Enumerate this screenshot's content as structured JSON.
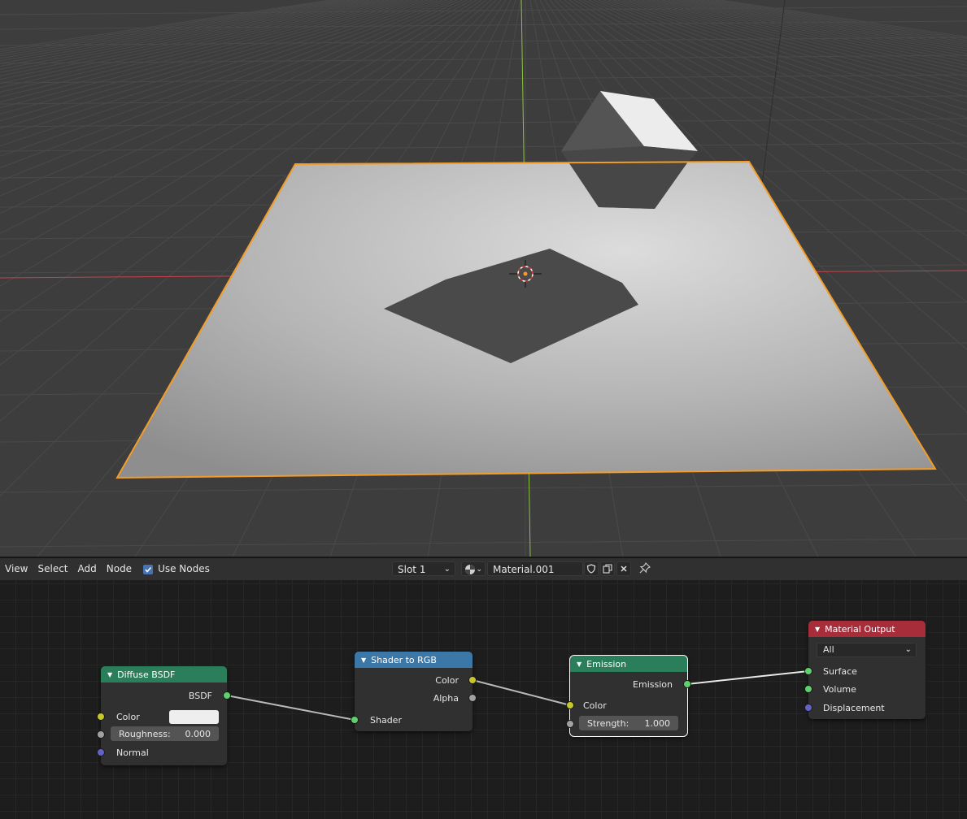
{
  "header": {
    "menu": [
      "View",
      "Select",
      "Add",
      "Node"
    ],
    "use_nodes_label": "Use Nodes",
    "use_nodes_checked": true,
    "slot": "Slot 1",
    "material_name": "Material.001"
  },
  "nodes": {
    "diffuse": {
      "title": "Diffuse BSDF",
      "output": "BSDF",
      "color_label": "Color",
      "roughness_label": "Roughness:",
      "roughness_value": "0.000",
      "normal_label": "Normal",
      "header_color": "#2a7f5a"
    },
    "shader_to_rgb": {
      "title": "Shader to RGB",
      "out_color": "Color",
      "out_alpha": "Alpha",
      "in_shader": "Shader",
      "header_color": "#3b78a8"
    },
    "emission": {
      "title": "Emission",
      "output": "Emission",
      "color_label": "Color",
      "strength_label": "Strength:",
      "strength_value": "1.000",
      "header_color": "#2a7f5a"
    },
    "material_output": {
      "title": "Material Output",
      "target": "All",
      "surface": "Surface",
      "volume": "Volume",
      "displacement": "Displacement",
      "header_color": "#a72d3b"
    }
  },
  "colors": {
    "selection_outline": "#f39c27",
    "x_axis": "#c4434d",
    "y_axis": "#8bc53f",
    "socket_shader": "#5fd16c",
    "socket_color": "#c7c729",
    "socket_float": "#a1a1a1",
    "socket_vector": "#6363c7"
  }
}
